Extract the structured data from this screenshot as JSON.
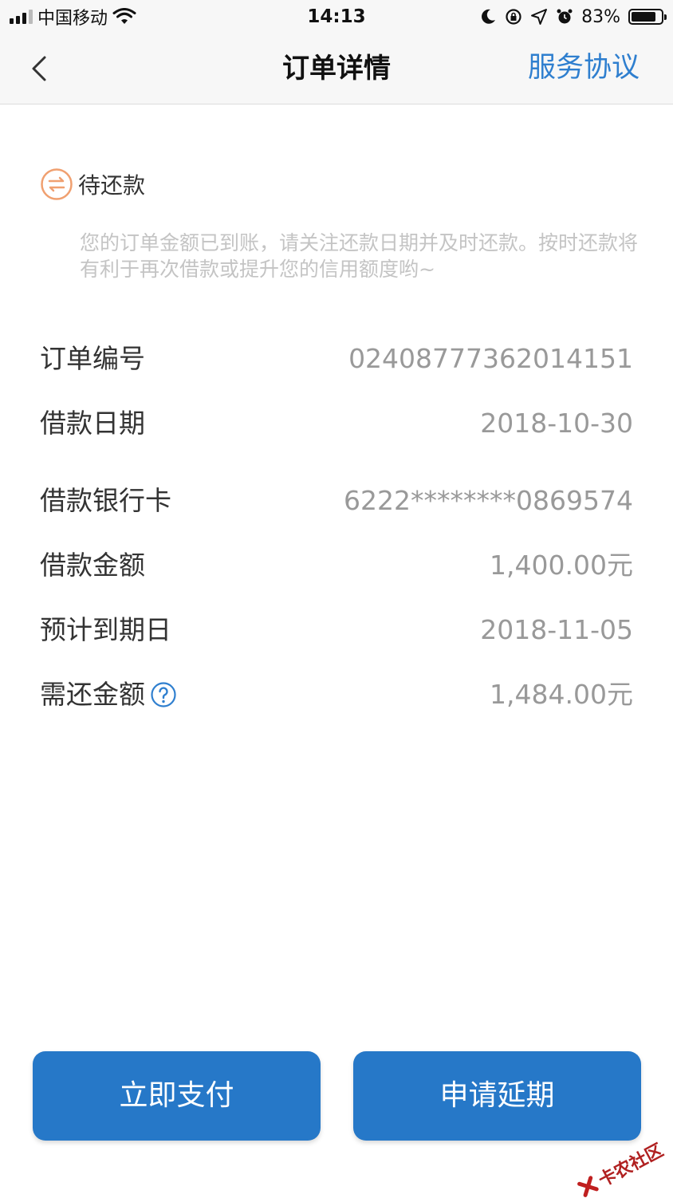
{
  "status_bar": {
    "carrier": "中国移动",
    "time": "14:13",
    "battery": "83%",
    "battery_level": 0.83
  },
  "nav": {
    "title": "订单详情",
    "right_link": "服务协议"
  },
  "order_status": {
    "label": "待还款",
    "notice": "您的订单金额已到账，请关注还款日期并及时还款。按时还款将有利于再次借款或提升您的信用额度哟~"
  },
  "details": [
    {
      "label": "订单编号",
      "value": "02408777362014151"
    },
    {
      "label": "借款日期",
      "value": "2018-10-30"
    },
    {
      "label": "借款银行卡",
      "value": "6222********0869574"
    },
    {
      "label": "借款金额",
      "value": "1,400.00元"
    },
    {
      "label": "预计到期日",
      "value": "2018-11-05"
    },
    {
      "label": "需还金额",
      "value": "1,484.00元"
    }
  ],
  "buttons": {
    "pay": "立即支付",
    "extend": "申请延期"
  },
  "colors": {
    "accent": "#2678c8",
    "link": "#2f7fcf",
    "status_icon": "#f0a070"
  },
  "watermark": "卡农社区"
}
